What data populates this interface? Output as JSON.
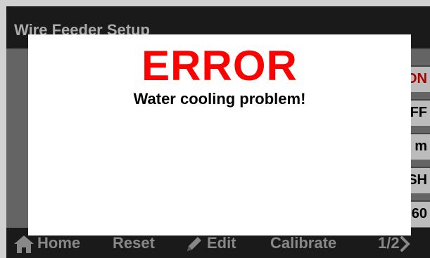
{
  "screen": {
    "title": "Wire Feeder Setup",
    "rows": [
      {
        "value": "ON",
        "status": "on"
      },
      {
        "value": "FF"
      },
      {
        "value": "m"
      },
      {
        "value": "SH"
      },
      {
        "value": "60"
      }
    ]
  },
  "bottom_bar": {
    "home_label": "Home",
    "reset_label": "Reset",
    "edit_label": "Edit",
    "calibrate_label": "Calibrate",
    "page_label": "1/2",
    "icons": {
      "home": "home-icon",
      "edit": "pencil-icon",
      "next": "chevron-right-icon"
    }
  },
  "dialog": {
    "title": "ERROR",
    "message": "Water cooling problem!",
    "title_color": "#ff0000"
  }
}
